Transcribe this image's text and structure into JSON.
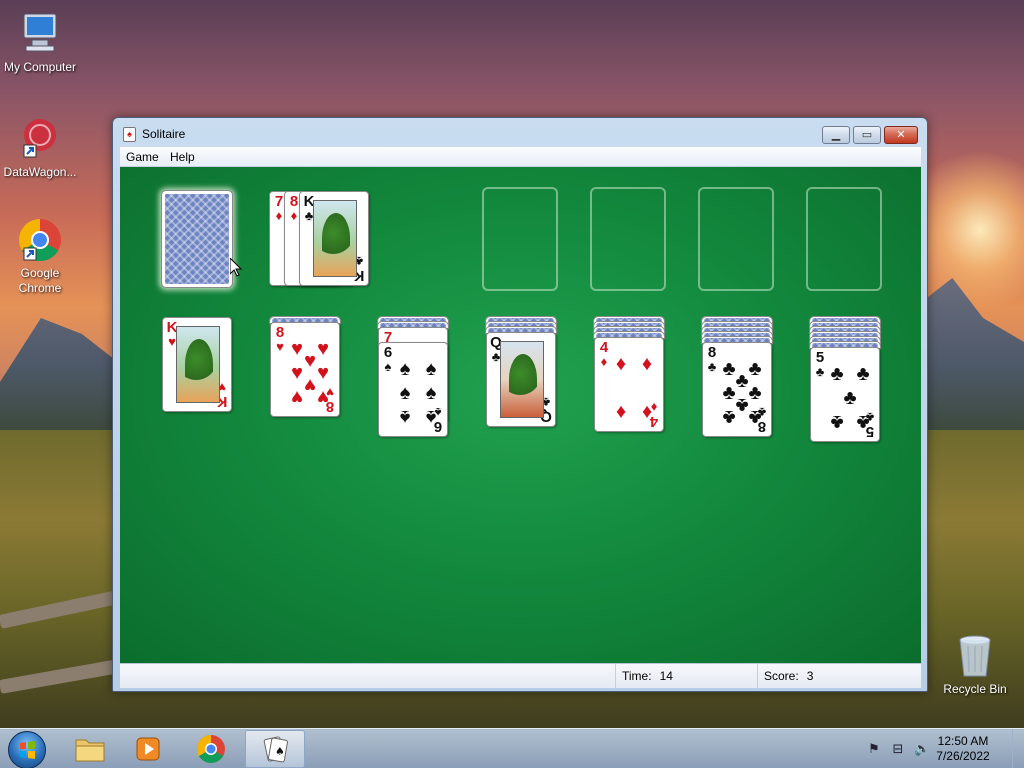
{
  "desktop": {
    "icons": [
      {
        "label": "My Computer",
        "icon": "computer-icon"
      },
      {
        "label": "DataWagon...",
        "icon": "datawagon-icon"
      },
      {
        "label": "Google Chrome",
        "icon": "chrome-icon"
      },
      {
        "label": "Recycle Bin",
        "icon": "recycle-bin-icon"
      }
    ]
  },
  "window": {
    "title": "Solitaire",
    "menu": [
      "Game",
      "Help"
    ],
    "status": {
      "time_label": "Time:",
      "time_value": "14",
      "score_label": "Score:",
      "score_value": "3"
    }
  },
  "game": {
    "stock": {
      "face": "down",
      "selected": true
    },
    "waste": [
      {
        "rank": "7",
        "suit": "♦",
        "color": "red"
      },
      {
        "rank": "8",
        "suit": "♦",
        "color": "red"
      },
      {
        "rank": "K",
        "suit": "♣",
        "color": "black"
      }
    ],
    "foundations": 4,
    "tableau": [
      {
        "hidden": 0,
        "visible": [
          {
            "rank": "K",
            "suit": "♥",
            "color": "red"
          }
        ]
      },
      {
        "hidden": 1,
        "visible": [
          {
            "rank": "8",
            "suit": "♥",
            "color": "red"
          }
        ]
      },
      {
        "hidden": 2,
        "visible": [
          {
            "rank": "7",
            "suit": "♥",
            "color": "red"
          },
          {
            "rank": "6",
            "suit": "♠",
            "color": "black"
          }
        ]
      },
      {
        "hidden": 3,
        "visible": [
          {
            "rank": "Q",
            "suit": "♣",
            "color": "black"
          }
        ]
      },
      {
        "hidden": 4,
        "visible": [
          {
            "rank": "4",
            "suit": "♦",
            "color": "red"
          }
        ]
      },
      {
        "hidden": 5,
        "visible": [
          {
            "rank": "8",
            "suit": "♣",
            "color": "black"
          }
        ]
      },
      {
        "hidden": 6,
        "visible": [
          {
            "rank": "5",
            "suit": "♣",
            "color": "black"
          }
        ]
      }
    ]
  },
  "taskbar": {
    "clock_time": "12:50 AM",
    "clock_date": "7/26/2022",
    "pinned": [
      "folder-icon",
      "media-player-icon",
      "chrome-icon",
      "solitaire-icon"
    ]
  },
  "colors": {
    "felt": "#138a3e",
    "red_suit": "#d3121c",
    "black_suit": "#111111"
  }
}
